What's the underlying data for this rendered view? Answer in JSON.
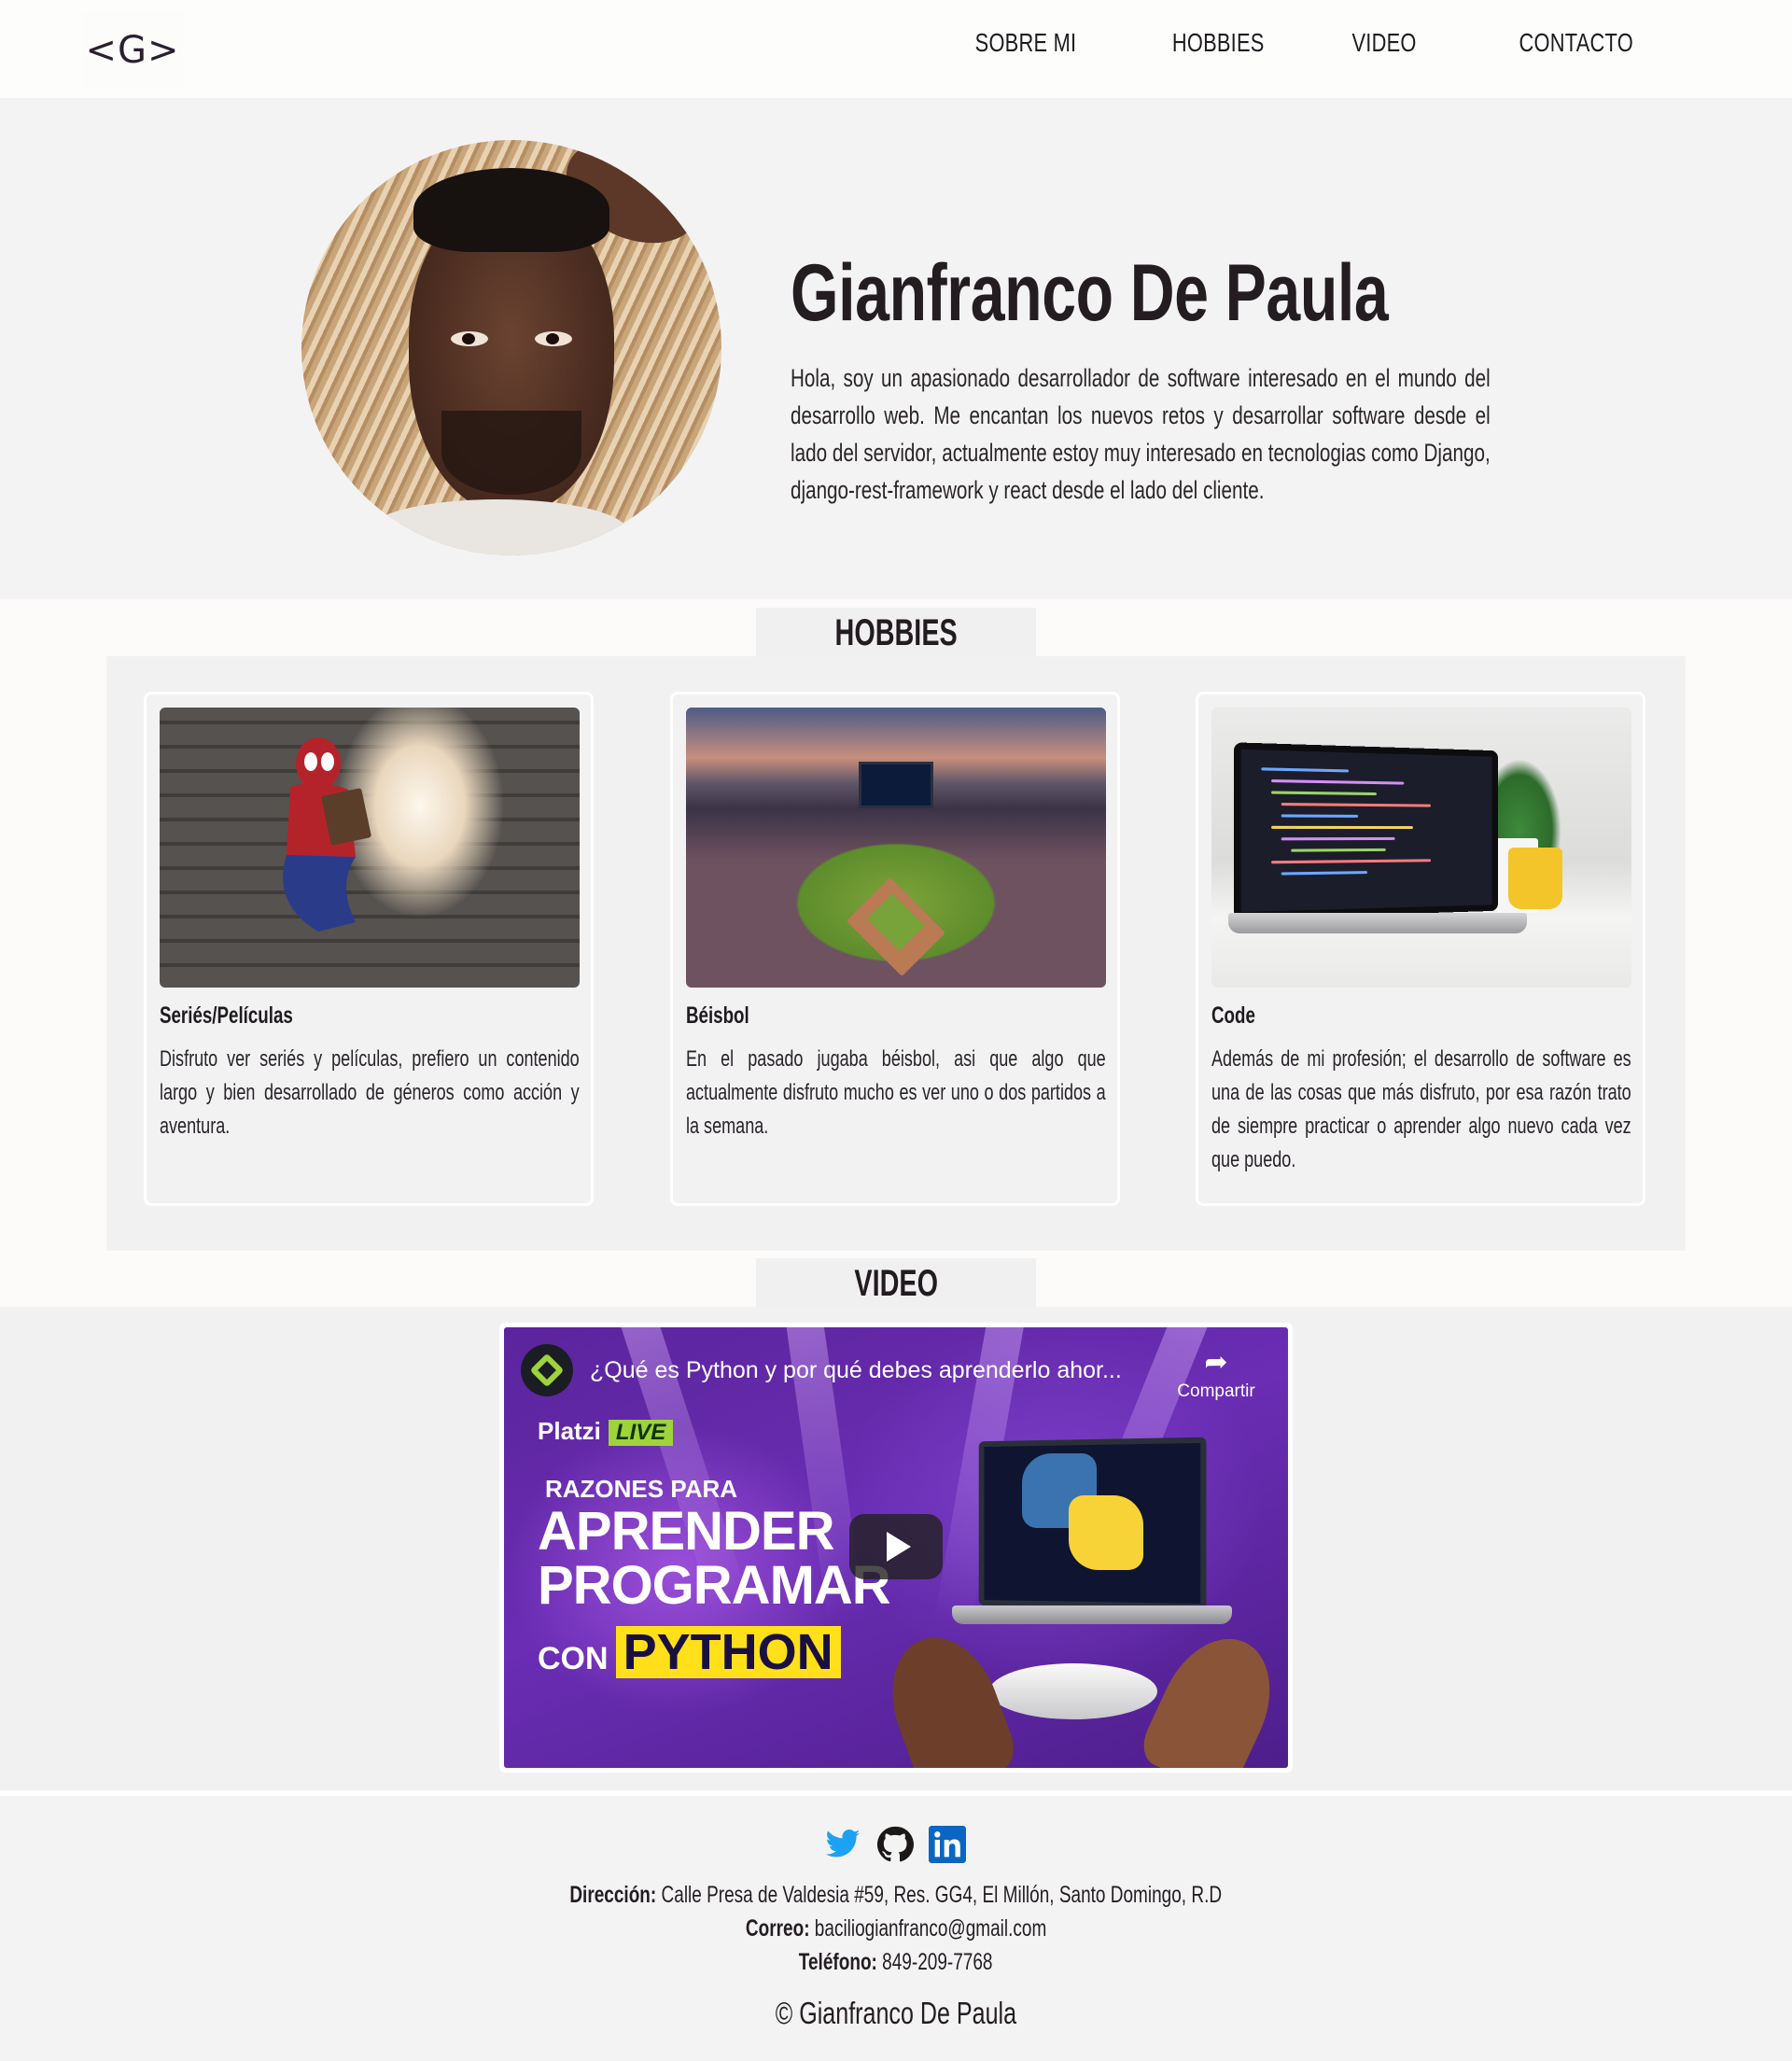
{
  "nav": {
    "logo": "<G>",
    "links": [
      "SOBRE MI",
      "HOBBIES",
      "VIDEO",
      "CONTACTO"
    ]
  },
  "hero": {
    "name": "Gianfranco De Paula",
    "intro": "Hola, soy un apasionado desarrollador de software interesado en el mundo del desarrollo web. Me encantan los nuevos retos y desarrollar software desde el lado del servidor, actualmente estoy muy interesado en tecnologias como Django, django-rest-framework y react desde el lado del cliente."
  },
  "hobbies": {
    "title": "HOBBIES",
    "cards": [
      {
        "title": "Seriés/Películas",
        "text": "Disfruto ver seriés y películas, prefiero un contenido largo y bien desarrollado de géneros como acción y aventura."
      },
      {
        "title": "Béisbol",
        "text": "En el pasado jugaba béisbol, asi que algo que actualmente disfruto mucho es ver uno o dos partidos a la semana."
      },
      {
        "title": "Code",
        "text": "Además de mi profesión; el desarrollo de software es una de las cosas que más disfruto, por esa razón trato de siempre practicar o aprender algo nuevo cada vez que puedo."
      }
    ]
  },
  "video": {
    "title": "VIDEO",
    "player_title": "¿Qué es Python y por qué debes aprenderlo ahor...",
    "share_label": "Compartir",
    "thumb_brand": "Platzi",
    "thumb_live": "LIVE",
    "thumb_reasons": "RAZONES PARA",
    "thumb_line1": "APRENDER",
    "thumb_line2": "PROGRAMAR",
    "thumb_con": "CON",
    "thumb_python": "PYTHON"
  },
  "footer": {
    "social": [
      "twitter-icon",
      "github-icon",
      "linkedin-icon"
    ],
    "address_label": "Dirección:",
    "address": "Calle Presa de Valdesia #59, Res. GG4, El Millón, Santo Domingo, R.D",
    "email_label": "Correo:",
    "email": "baciliogianfranco@gmail.com",
    "phone_label": "Teléfono:",
    "phone": "849-209-7768",
    "copyright": "© Gianfranco De Paula"
  },
  "colors": {
    "background": "#f4f3f4",
    "text": "#1e1b1e",
    "twitter": "#1da1f2",
    "linkedin": "#0a66c2",
    "video_purple": "#6a2db4"
  }
}
